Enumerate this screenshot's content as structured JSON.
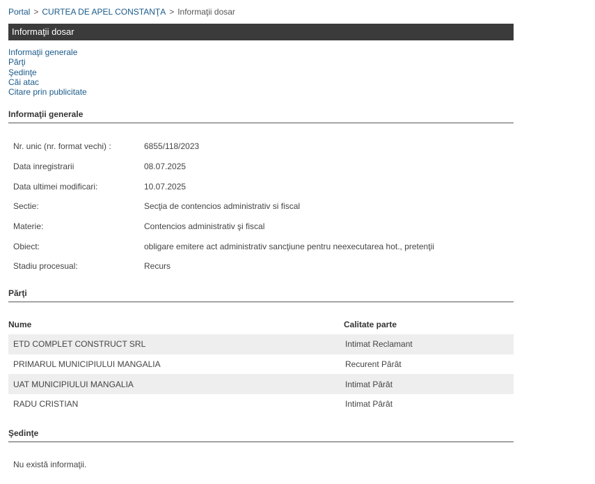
{
  "breadcrumb": {
    "portal": "Portal",
    "separator": ">",
    "court": "CURTEA DE APEL CONSTANŢA",
    "current": "Informaţii dosar"
  },
  "title": "Informaţii dosar",
  "anchors": [
    "Informaţii generale",
    "Părţi",
    "Şedinţe",
    "Căi atac",
    "Citare prin publicitate"
  ],
  "general": {
    "heading": "Informaţii generale",
    "rows": [
      {
        "label": "Nr. unic (nr. format vechi) :",
        "value": "6855/118/2023"
      },
      {
        "label": "Data inregistrarii",
        "value": "08.07.2025"
      },
      {
        "label": "Data ultimei modificari:",
        "value": "10.07.2025"
      },
      {
        "label": "Sectie:",
        "value": "Secţia de contencios administrativ si fiscal"
      },
      {
        "label": "Materie:",
        "value": "Contencios administrativ şi fiscal"
      },
      {
        "label": "Obiect:",
        "value": "obligare emitere act administrativ sancţiune pentru neexecutarea hot., pretenţii"
      },
      {
        "label": "Stadiu procesual:",
        "value": "Recurs"
      }
    ]
  },
  "parties": {
    "heading": "Părţi",
    "columns": {
      "name": "Nume",
      "role": "Calitate parte"
    },
    "rows": [
      {
        "name": "ETD COMPLET CONSTRUCT SRL",
        "role": "Intimat Reclamant"
      },
      {
        "name": "PRIMARUL MUNICIPIULUI MANGALIA",
        "role": "Recurent Pârât"
      },
      {
        "name": "UAT MUNICIPIULUI MANGALIA",
        "role": "Intimat Pârât"
      },
      {
        "name": "RADU CRISTIAN",
        "role": "Intimat Pârât"
      }
    ]
  },
  "hearings": {
    "heading": "Şedinţe",
    "empty_text": "Nu există informaţii."
  }
}
